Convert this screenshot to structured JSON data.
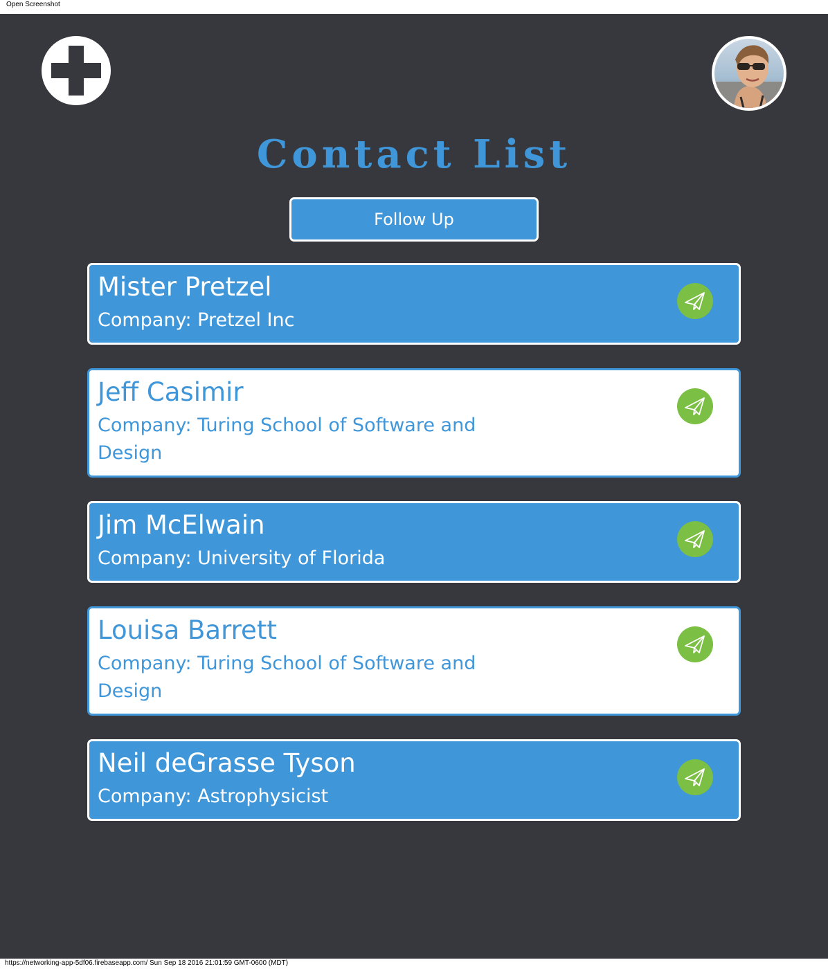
{
  "window": {
    "header_text": "Open Screenshot",
    "footer_text": "https://networking-app-5df06.firebaseapp.com/ Sun Sep 18 2016 21:01:59 GMT-0600 (MDT)"
  },
  "header": {
    "add_icon": "plus-icon",
    "avatar_icon": "user-photo"
  },
  "page": {
    "title": "Contact List",
    "follow_up_label": "Follow Up"
  },
  "contacts": [
    {
      "name": "Mister Pretzel",
      "company": "Company: Pretzel Inc",
      "style": "blue"
    },
    {
      "name": "Jeff Casimir",
      "company": "Company: Turing School of Software and Design",
      "style": "white"
    },
    {
      "name": "Jim McElwain",
      "company": "Company: University of Florida",
      "style": "blue"
    },
    {
      "name": "Louisa Barrett",
      "company": "Company: Turing School of Software and Design",
      "style": "white"
    },
    {
      "name": "Neil deGrasse Tyson",
      "company": "Company: Astrophysicist",
      "style": "blue"
    }
  ],
  "colors": {
    "background": "#37383d",
    "accent_blue": "#3f96d9",
    "send_green": "#7bbf45"
  }
}
